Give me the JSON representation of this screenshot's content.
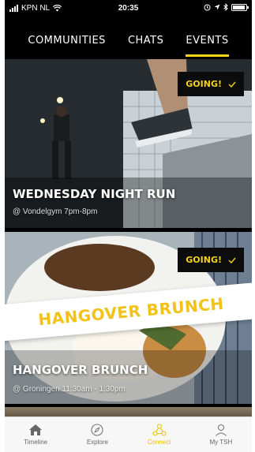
{
  "status_bar": {
    "carrier": "KPN NL",
    "time": "20:35"
  },
  "tabs": [
    {
      "label": "COMMUNITIES",
      "active": false
    },
    {
      "label": "CHATS",
      "active": false
    },
    {
      "label": "EVENTS",
      "active": true
    }
  ],
  "events": [
    {
      "title": "WEDNESDAY NIGHT RUN",
      "subtitle": "@ Vondelgym 7pm-8pm",
      "status_label": "GOING!",
      "status_icon": "checkmark-icon"
    },
    {
      "title": "HANGOVER BRUNCH",
      "subtitle": "@ Groningen 11:30am - 1:30pm",
      "status_label": "GOING!",
      "status_icon": "checkmark-icon",
      "banner_text": "HANGOVER BRUNCH"
    }
  ],
  "bottom_nav": [
    {
      "label": "Timeline",
      "icon": "home-icon",
      "active": false
    },
    {
      "label": "Explore",
      "icon": "compass-icon",
      "active": false
    },
    {
      "label": "Connect",
      "icon": "connect-icon",
      "active": true
    },
    {
      "label": "My TSH",
      "icon": "person-icon",
      "active": false
    }
  ],
  "colors": {
    "accent": "#f5d21a",
    "background": "#000000",
    "nav_background": "#f7f7f7"
  }
}
